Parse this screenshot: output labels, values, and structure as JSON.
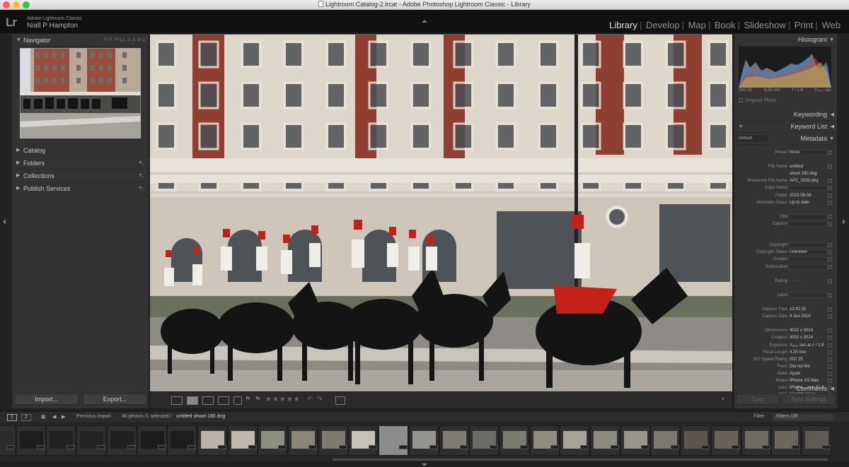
{
  "window": {
    "title": "Lightroom Catalog-2.lrcat - Adobe Photoshop Lightroom Classic - Library"
  },
  "identity": {
    "logo": "Lr",
    "app_name": "Adobe Lightroom Classic",
    "user": "Niall P Hampton"
  },
  "modules": [
    "Library",
    "Develop",
    "Map",
    "Book",
    "Slideshow",
    "Print",
    "Web"
  ],
  "left_panel": {
    "navigator": {
      "title": "Navigator",
      "options": "FIT  FILL  1:1  3:1"
    },
    "sections": [
      {
        "label": "Catalog",
        "has_plus": false
      },
      {
        "label": "Folders",
        "has_plus": true
      },
      {
        "label": "Collections",
        "has_plus": true
      },
      {
        "label": "Publish Services",
        "has_plus": true
      }
    ],
    "import_label": "Import...",
    "export_label": "Export..."
  },
  "right_panel": {
    "histogram_title": "Histogram",
    "histogram_info": {
      "iso": "ISO 25",
      "focal": "4.25 mm",
      "aperture": "f / 1.8",
      "shutter": "¹⁄₁₅₀₀ sec"
    },
    "original_photo": "Original Photo",
    "keywording": "Keywording",
    "keyword_list": "Keyword List",
    "metadata": "Metadata",
    "metadata_preset_select": "Default",
    "rows": [
      {
        "label": "Preset",
        "value": "None",
        "type": "select"
      },
      {
        "label": "",
        "value": "",
        "type": "spacer"
      },
      {
        "label": "File Name",
        "value": "untitled",
        "type": "text"
      },
      {
        "label": "",
        "value": "shoot-180.dng",
        "type": "text"
      },
      {
        "label": "Preserved File Name",
        "value": "APC_0230.dng",
        "type": "text"
      },
      {
        "label": "Copy Name",
        "value": "",
        "type": "box"
      },
      {
        "label": "Folder",
        "value": "2019-06-08",
        "type": "text"
      },
      {
        "label": "Metadata Status",
        "value": "Up to date",
        "type": "text"
      },
      {
        "label": "",
        "value": "",
        "type": "spacer"
      },
      {
        "label": "Title",
        "value": "",
        "type": "box"
      },
      {
        "label": "Caption",
        "value": "",
        "type": "box"
      },
      {
        "label": "",
        "value": "",
        "type": "spacer"
      },
      {
        "label": "",
        "value": "",
        "type": "spacer"
      },
      {
        "label": "Copyright",
        "value": "",
        "type": "box"
      },
      {
        "label": "Copyright Status",
        "value": "Unknown",
        "type": "select"
      },
      {
        "label": "Creator",
        "value": "",
        "type": "box"
      },
      {
        "label": "Sublocation",
        "value": "",
        "type": "box"
      },
      {
        "label": "",
        "value": "",
        "type": "spacer"
      },
      {
        "label": "Rating",
        "value": "· · · · ·",
        "type": "text"
      },
      {
        "label": "",
        "value": "",
        "type": "spacer"
      },
      {
        "label": "Label",
        "value": "",
        "type": "box"
      },
      {
        "label": "",
        "value": "",
        "type": "spacer"
      },
      {
        "label": "Capture Time",
        "value": "12:41:35",
        "type": "text"
      },
      {
        "label": "Capture Date",
        "value": "8 Jun 2019",
        "type": "text"
      },
      {
        "label": "",
        "value": "",
        "type": "spacer"
      },
      {
        "label": "Dimensions",
        "value": "4032 x 3024",
        "type": "text"
      },
      {
        "label": "Cropped",
        "value": "4032 x 3024",
        "type": "text"
      },
      {
        "label": "Exposure",
        "value": "¹⁄₁₅₀₀ sec at ƒ / 1.8",
        "type": "text"
      },
      {
        "label": "Focal Length",
        "value": "4.25 mm",
        "type": "text"
      },
      {
        "label": "ISO Speed Rating",
        "value": "ISO 25",
        "type": "text"
      },
      {
        "label": "Flash",
        "value": "Did not fire",
        "type": "text"
      },
      {
        "label": "Make",
        "value": "Apple",
        "type": "text"
      },
      {
        "label": "Model",
        "value": "iPhone XS Max",
        "type": "text"
      },
      {
        "label": "Lens",
        "value": "iPhone....mm f/1.8",
        "type": "text"
      },
      {
        "label": "GPS",
        "value": "51°30'9.23\" N",
        "type": "text"
      },
      {
        "label": "",
        "value": "0°9'38.091\" W",
        "type": "text"
      }
    ],
    "comments": "Comments",
    "sync_label": "Sync",
    "sync_settings_label": "Sync Settings"
  },
  "filmstrip_bar": {
    "page1": "1",
    "page2": "2",
    "source": "Previous Import",
    "count": "45 photos /1 selected /",
    "selected_file": "untitled shoot-180.dng",
    "filter_label": "Filter :",
    "filter_value": "Filters Off"
  },
  "colors": {
    "accent_active": "#e2e2e2",
    "panel_bg": "#333333",
    "background": "#1f1f1f"
  }
}
